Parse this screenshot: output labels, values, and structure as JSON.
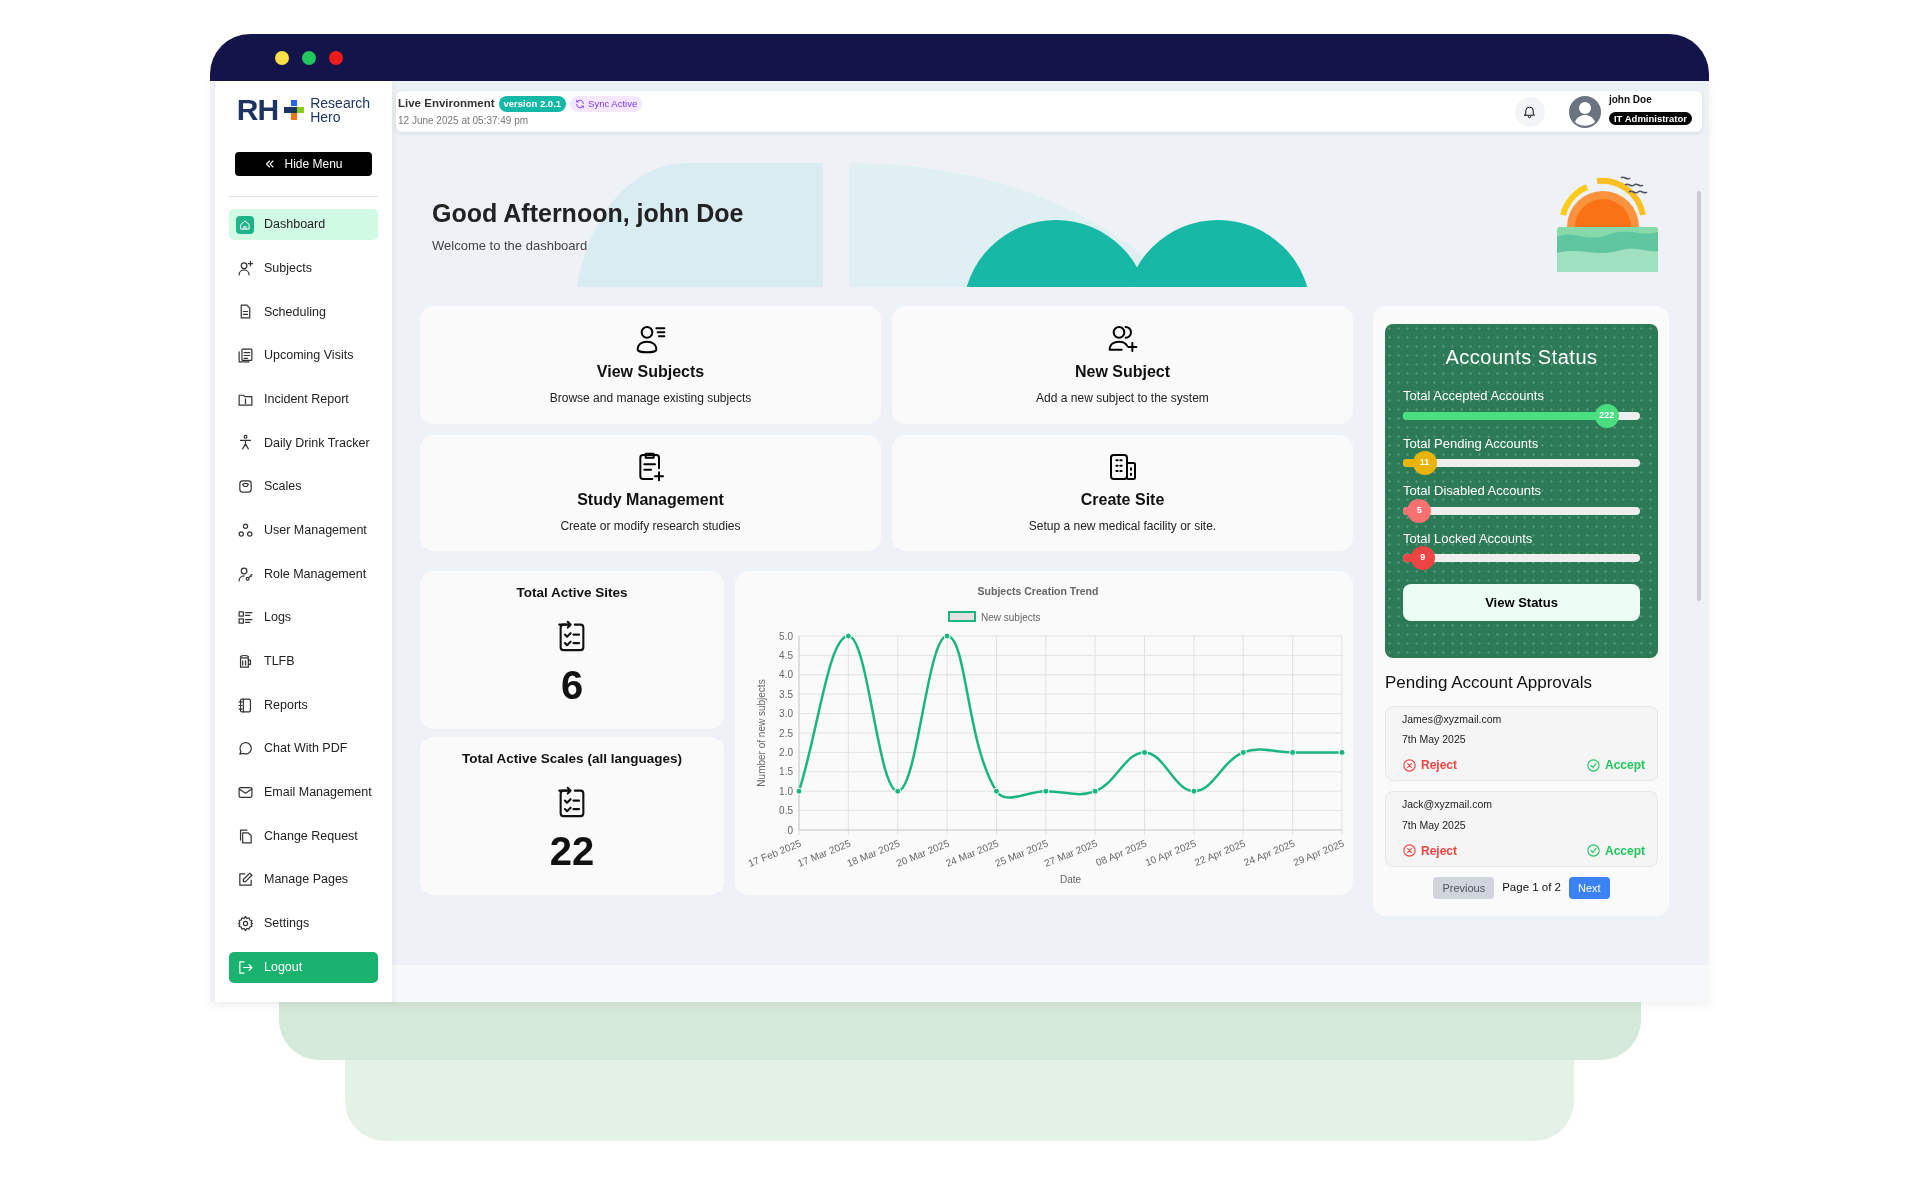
{
  "sidebar": {
    "brand": {
      "mark": "RH",
      "name_lines": [
        "Research",
        "Hero"
      ]
    },
    "hide_button": "Hide Menu",
    "items": [
      {
        "label": "Dashboard",
        "selected": true
      },
      {
        "label": "Subjects",
        "selected": false
      },
      {
        "label": "Scheduling",
        "selected": false
      },
      {
        "label": "Upcoming Visits",
        "selected": false
      },
      {
        "label": "Incident Report",
        "selected": false
      },
      {
        "label": "Daily Drink Tracker",
        "selected": false
      },
      {
        "label": "Scales",
        "selected": false
      },
      {
        "label": "User Management",
        "selected": false
      },
      {
        "label": "Role Management",
        "selected": false
      },
      {
        "label": "Logs",
        "selected": false
      },
      {
        "label": "TLFB",
        "selected": false
      },
      {
        "label": "Reports",
        "selected": false
      },
      {
        "label": "Chat With PDF",
        "selected": false
      },
      {
        "label": "Email Management",
        "selected": false
      },
      {
        "label": "Change Request",
        "selected": false
      },
      {
        "label": "Manage Pages",
        "selected": false
      },
      {
        "label": "Settings",
        "selected": false
      }
    ],
    "logout": "Logout"
  },
  "header": {
    "environment": "Live Environment",
    "version": "version 2.0.1",
    "sync": "Sync Active",
    "timestamp": "12 June 2025 at 05:37:49 pm",
    "user": {
      "name": "john Doe",
      "role": "IT Administrator"
    }
  },
  "hero": {
    "greeting": "Good Afternoon, john Doe",
    "subtitle": "Welcome to the dashboard"
  },
  "actions": [
    {
      "title": "View Subjects",
      "description": "Browse and manage existing subjects"
    },
    {
      "title": "New Subject",
      "description": "Add a new subject to the system"
    },
    {
      "title": "Study Management",
      "description": "Create or modify research studies"
    },
    {
      "title": "Create Site",
      "description": "Setup a new medical facility or site."
    }
  ],
  "stats": [
    {
      "label": "Total Active Sites",
      "value": "6"
    },
    {
      "label": "Total Active Scales (all languages)",
      "value": "22"
    }
  ],
  "trend": {
    "chart_data": {
      "type": "line",
      "title": "Subjects Creation Trend",
      "xlabel": "Date",
      "ylabel": "Number of new subjects",
      "categories": [
        "17 Feb 2025",
        "17 Mar 2025",
        "18 Mar 2025",
        "20 Mar 2025",
        "24 Mar 2025",
        "25 Mar 2025",
        "27 Mar 2025",
        "08 Apr 2025",
        "10 Apr 2025",
        "22 Apr 2025",
        "24 Apr 2025",
        "29 Apr 2025"
      ],
      "series": [
        {
          "name": "New subjects",
          "color": "#1ab67e",
          "values": [
            1,
            5,
            1,
            5,
            1,
            1,
            1,
            2,
            1,
            2,
            2,
            2
          ]
        }
      ],
      "ylim": [
        0,
        5
      ],
      "grid": true,
      "marker": true,
      "yticks": [
        0,
        0.5,
        {
          "value": 1,
          "label": "1.0"
        },
        1.5,
        {
          "value": 2,
          "label": "2.0"
        },
        2.5,
        {
          "value": 3,
          "label": "3.0"
        },
        3.5,
        {
          "value": 4,
          "label": "4.0"
        },
        4.5,
        {
          "value": 5,
          "label": "5.0"
        }
      ]
    }
  },
  "accounts_status": {
    "title": "Accounts Status",
    "meters": [
      {
        "label": "Total Accepted Accounts",
        "reading": "222",
        "level": 0.9,
        "color": "#4ade80"
      },
      {
        "label": "Total Pending Accounts",
        "reading": "11",
        "level": 0.045,
        "color": "#eab308"
      },
      {
        "label": "Total Disabled Accounts",
        "reading": "5",
        "level": 0.02,
        "color": "#f87171"
      },
      {
        "label": "Total Locked Accounts",
        "reading": "9",
        "level": 0.036,
        "color": "#ef4444"
      }
    ],
    "button": "View Status"
  },
  "approvals": {
    "title": "Pending Account Approvals",
    "items": [
      {
        "email": "James@xyzmail.com",
        "date": "7th May 2025",
        "reject": "Reject",
        "accept": "Accept"
      },
      {
        "email": "Jack@xyzmail.com",
        "date": "7th May 2025",
        "reject": "Reject",
        "accept": "Accept"
      }
    ],
    "pagination": {
      "previous": {
        "label": "Previous",
        "disabled": true
      },
      "page": "Page 1 of 2",
      "next": {
        "label": "Next",
        "disabled": false
      }
    }
  }
}
